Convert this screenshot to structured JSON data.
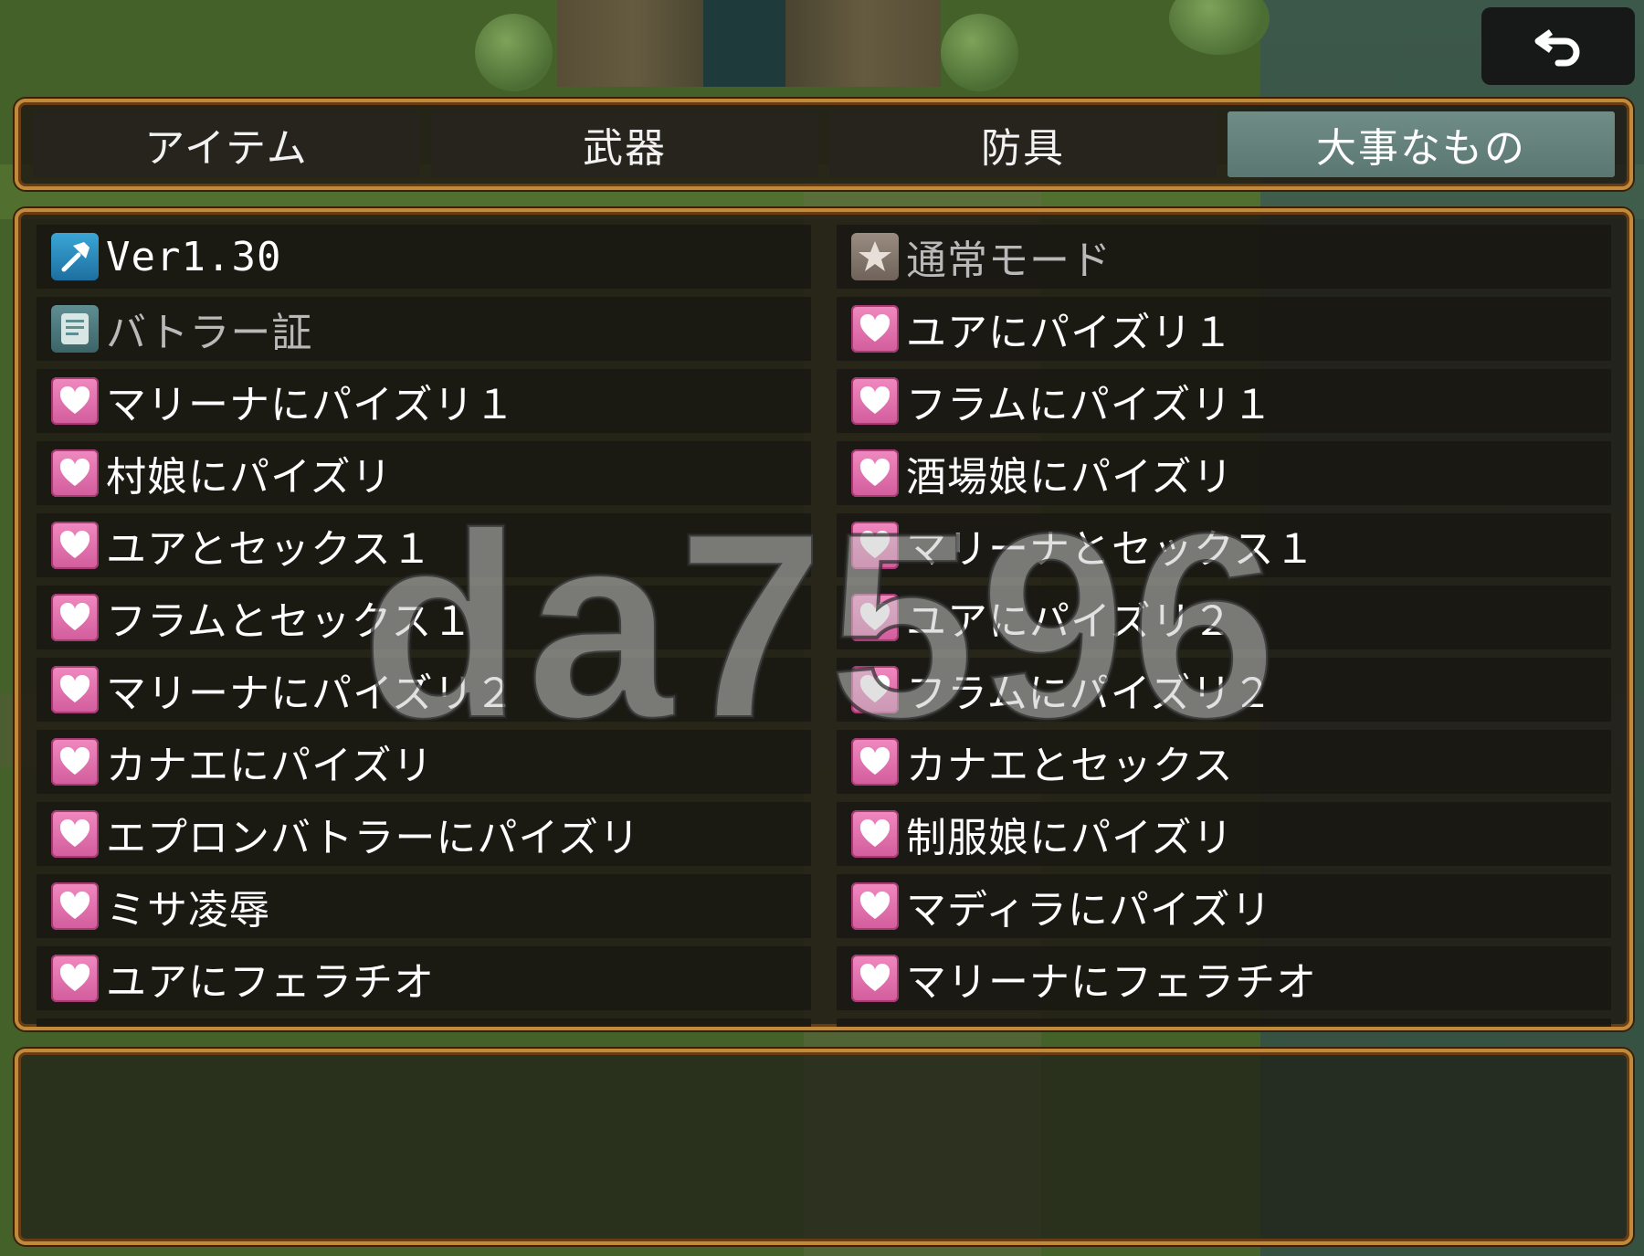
{
  "tabs": [
    {
      "label": "アイテム",
      "active": false
    },
    {
      "label": "武器",
      "active": false
    },
    {
      "label": "防具",
      "active": false
    },
    {
      "label": "大事なもの",
      "active": true
    }
  ],
  "items": [
    {
      "label": "Ver1.30",
      "icon": "hammer-icon",
      "dim": false
    },
    {
      "label": "通常モード",
      "icon": "star-icon",
      "dim": true
    },
    {
      "label": "バトラー証",
      "icon": "card-icon",
      "dim": true
    },
    {
      "label": "ユアにパイズリ１",
      "icon": "heart-icon",
      "dim": false
    },
    {
      "label": "マリーナにパイズリ１",
      "icon": "heart-icon",
      "dim": false
    },
    {
      "label": "フラムにパイズリ１",
      "icon": "heart-icon",
      "dim": false
    },
    {
      "label": "村娘にパイズリ",
      "icon": "heart-icon",
      "dim": false
    },
    {
      "label": "酒場娘にパイズリ",
      "icon": "heart-icon",
      "dim": false
    },
    {
      "label": "ユアとセックス１",
      "icon": "heart-icon",
      "dim": false
    },
    {
      "label": "マリーナとセックス１",
      "icon": "heart-icon",
      "dim": false
    },
    {
      "label": "フラムとセックス１",
      "icon": "heart-icon",
      "dim": false
    },
    {
      "label": "ユアにパイズリ２",
      "icon": "heart-icon",
      "dim": false
    },
    {
      "label": "マリーナにパイズリ２",
      "icon": "heart-icon",
      "dim": false
    },
    {
      "label": "フラムにパイズリ２",
      "icon": "heart-icon",
      "dim": false
    },
    {
      "label": "カナエにパイズリ",
      "icon": "heart-icon",
      "dim": false
    },
    {
      "label": "カナエとセックス",
      "icon": "heart-icon",
      "dim": false
    },
    {
      "label": "エプロンバトラーにパイズリ",
      "icon": "heart-icon",
      "dim": false
    },
    {
      "label": "制服娘にパイズリ",
      "icon": "heart-icon",
      "dim": false
    },
    {
      "label": "ミサ凌辱",
      "icon": "heart-icon",
      "dim": false
    },
    {
      "label": "マディラにパイズリ",
      "icon": "heart-icon",
      "dim": false
    },
    {
      "label": "ユアにフェラチオ",
      "icon": "heart-icon",
      "dim": false
    },
    {
      "label": "マリーナにフェラチオ",
      "icon": "heart-icon",
      "dim": false
    }
  ],
  "description": "",
  "watermark": "da7596",
  "colors": {
    "frame": "#c08a3a",
    "active_tab": "#6f8c86",
    "heart": "#e275b0"
  }
}
